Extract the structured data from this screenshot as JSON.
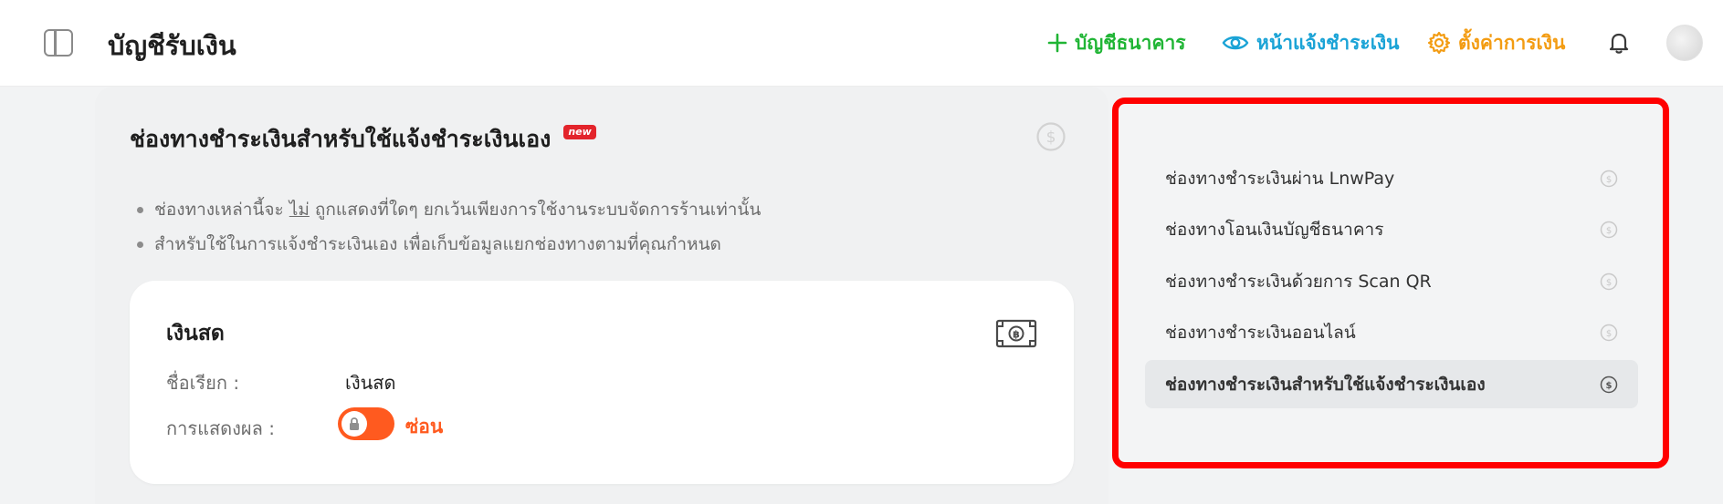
{
  "header": {
    "title": "บัญชีรับเงิน",
    "actions": {
      "bank_account": "บัญชีธนาคาร",
      "payment_notify": "หน้าแจ้งชำระเงิน",
      "settings": "ตั้งค่าการเงิน"
    },
    "colors": {
      "bank": "#20b535",
      "notify": "#1aa3d6",
      "settings": "#f39c12"
    }
  },
  "main": {
    "title": "ช่องทางชำระเงินสำหรับใช้แจ้งชำระเงินเอง",
    "badge": "new",
    "notes": {
      "line1_before": "ช่องทางเหล่านี้จะ ",
      "line1_emph": "ไม่",
      "line1_after": " ถูกแสดงที่ใดๆ ยกเว้นเพียงการใช้งานระบบจัดการร้านเท่านั้น",
      "line2": "สำหรับใช้ในการแจ้งชำระเงินเอง เพื่อเก็บข้อมูลแยกช่องทางตามที่คุณกำหนด"
    },
    "cash_card": {
      "title": "เงินสด",
      "name_label": "ชื่อเรียก :",
      "name_value": "เงินสด",
      "display_label": "การแสดงผล :",
      "display_state": "ซ่อน",
      "toggle_color": "#ff5a1f"
    }
  },
  "right_nav": {
    "items": [
      {
        "label": "ช่องทางชำระเงินผ่าน LnwPay",
        "active": false
      },
      {
        "label": "ช่องทางโอนเงินบัญชีธนาคาร",
        "active": false
      },
      {
        "label": "ช่องทางชำระเงินด้วยการ Scan QR",
        "active": false
      },
      {
        "label": "ช่องทางชำระเงินออนไลน์",
        "active": false
      },
      {
        "label": "ช่องทางชำระเงินสำหรับใช้แจ้งชำระเงินเอง",
        "active": true
      }
    ],
    "highlight_color": "#ff0000"
  }
}
